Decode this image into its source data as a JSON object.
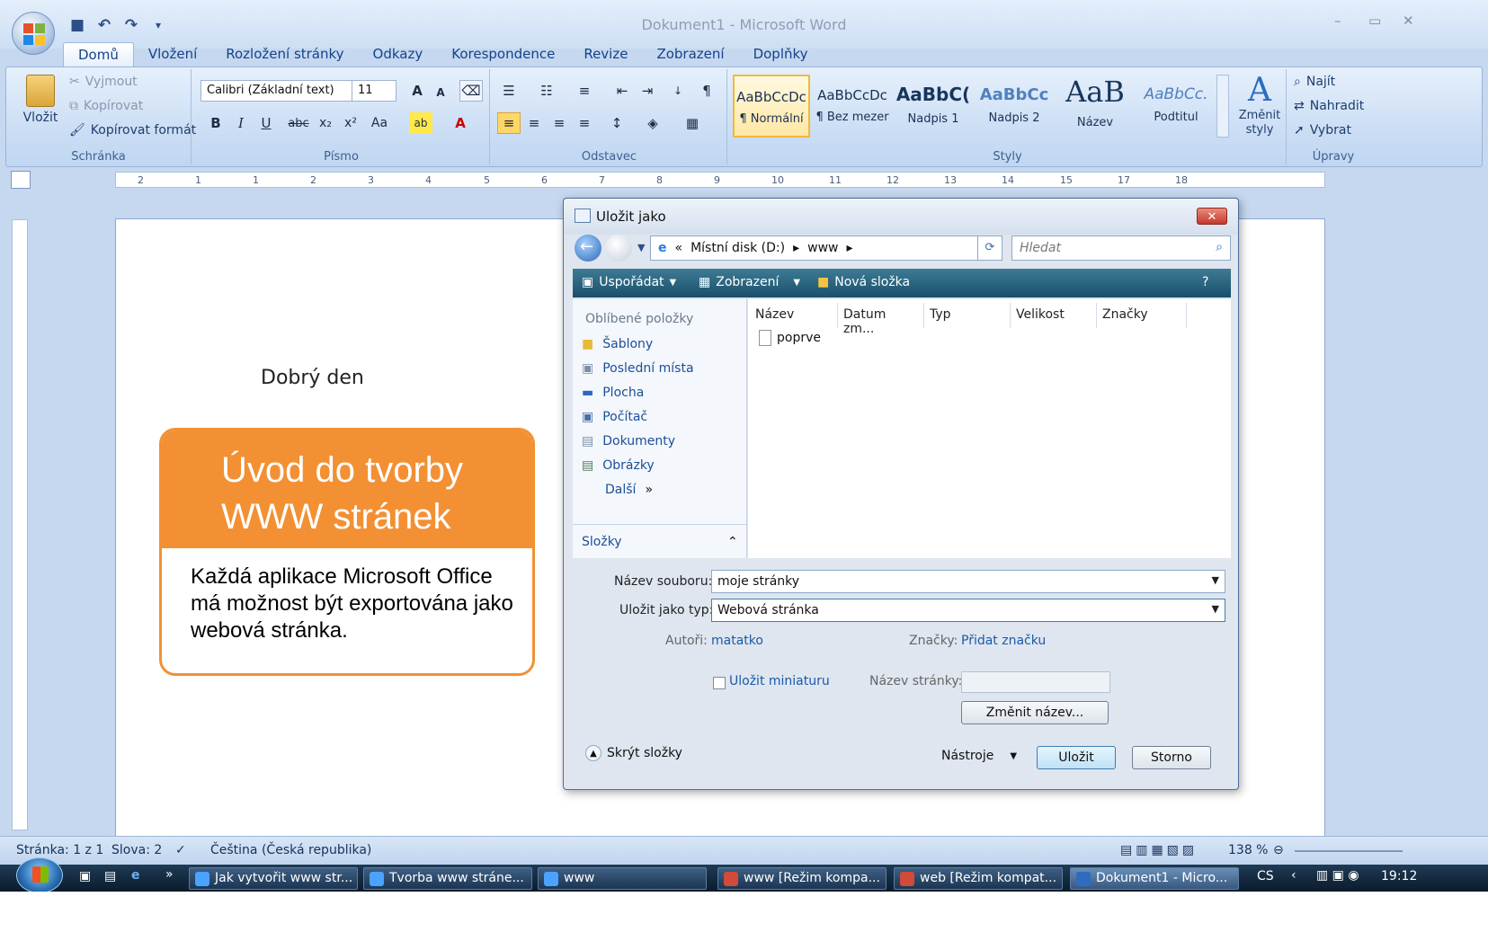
{
  "window": {
    "title": "Dokument1 - Microsoft Word",
    "minimize": "–",
    "restore": "▭",
    "close": "✕"
  },
  "qat": {
    "save": "■",
    "undo": "↶",
    "redo": "↷",
    "customize": "▾"
  },
  "tabs": [
    "Domů",
    "Vložení",
    "Rozložení stránky",
    "Odkazy",
    "Korespondence",
    "Revize",
    "Zobrazení",
    "Doplňky"
  ],
  "ribbon": {
    "clipboard": {
      "paste": "Vložit",
      "cut": "Vyjmout",
      "copy": "Kopírovat",
      "format_painter": "Kopírovat formát",
      "label": "Schránka"
    },
    "font": {
      "family": "Calibri (Základní text)",
      "size": "11",
      "label": "Písmo",
      "bold": "B",
      "italic": "I",
      "underline": "U",
      "strike": "abc",
      "subscript": "x₂",
      "superscript": "x²",
      "case": "Aa",
      "grow": "A",
      "shrink": "A",
      "color": "A",
      "highlight": "ab"
    },
    "paragraph": {
      "label": "Odstavec",
      "pilcrow": "¶"
    },
    "styles": {
      "label": "Styly",
      "items": [
        {
          "sample": "AaBbCcDc",
          "name": "¶ Normální"
        },
        {
          "sample": "AaBbCcDc",
          "name": "¶ Bez mezer"
        },
        {
          "sample": "AaBbC(",
          "name": "Nadpis 1"
        },
        {
          "sample": "AaBbCc",
          "name": "Nadpis 2"
        },
        {
          "sample": "AaB",
          "name": "Název"
        },
        {
          "sample": "AaBbCc.",
          "name": "Podtitul"
        }
      ],
      "change_styles": "Změnit styly"
    },
    "editing": {
      "label": "Úpravy",
      "find": "Najít",
      "replace": "Nahradit",
      "select": "Vybrat"
    }
  },
  "ruler": {
    "marks": [
      "2",
      "1",
      "1",
      "2",
      "3",
      "4",
      "5",
      "6",
      "7",
      "8",
      "9",
      "10",
      "11",
      "12",
      "13",
      "14",
      "15",
      "17",
      "18"
    ]
  },
  "document": {
    "greeting": "Dobrý den"
  },
  "card": {
    "title": "Úvod do tvorby WWW stránek",
    "body": "Každá aplikace Microsoft Office má možnost být exportována jako webová stránka."
  },
  "dialog": {
    "title": "Uložit jako",
    "address": [
      "«",
      "Místní disk (D:)",
      "▸",
      "www",
      "▸"
    ],
    "search_placeholder": "Hledat",
    "toolbar": {
      "organize": "Uspořádat",
      "views": "Zobrazení",
      "new_folder": "Nová složka"
    },
    "favorites_header": "Oblíbené položky",
    "favorites": [
      "Šablony",
      "Poslední místa",
      "Plocha",
      "Počítač",
      "Dokumenty",
      "Obrázky",
      "Další"
    ],
    "folders": "Složky",
    "columns": [
      "Název",
      "Datum zm...",
      "Typ",
      "Velikost",
      "Značky"
    ],
    "files": [
      "poprve"
    ],
    "filename_label": "Název souboru:",
    "filename": "moje stránky",
    "type_label": "Uložit jako typ:",
    "type": "Webová stránka",
    "authors_label": "Autoři:",
    "authors": "matatko",
    "tags_label": "Značky:",
    "tags": "Přidat značku",
    "thumbnail": "Uložit miniaturu",
    "page_title_label": "Název stránky:",
    "change_title": "Změnit název...",
    "hide_folders": "Skrýt složky",
    "tools": "Nástroje",
    "save": "Uložit",
    "cancel": "Storno"
  },
  "status": {
    "page": "Stránka: 1 z 1",
    "words": "Slova: 2",
    "language": "Čeština (Česká republika)",
    "zoom": "138 %"
  },
  "taskbar": {
    "items": [
      "Jak vytvořit www str...",
      "Tvorba www stráne...",
      "www",
      "www [Režim kompa...",
      "web [Režim kompat...",
      "Dokument1 - Micro..."
    ],
    "lang": "CS",
    "time": "19:12"
  },
  "colors": {
    "accent_orange": "#f39033",
    "ribbon_blue": "#c9dcf4",
    "dialog_toolbar": "#1a4f6a"
  }
}
